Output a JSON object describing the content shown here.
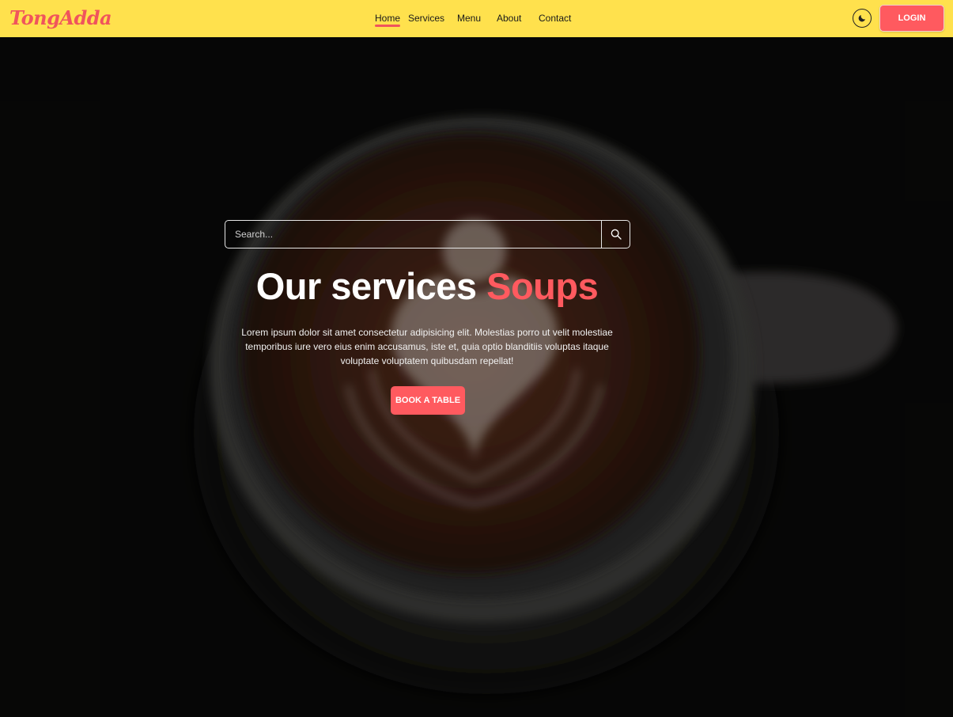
{
  "brand": {
    "logo_text": "TongAdda",
    "logo_color": "#f0545c"
  },
  "nav": {
    "items": [
      {
        "label": "Home",
        "active": true
      },
      {
        "label": "Services"
      },
      {
        "label": "Menu"
      },
      {
        "label": "About"
      },
      {
        "label": "Contact"
      }
    ]
  },
  "header": {
    "login_label": "LOGIN",
    "theme_icon": "moon-icon",
    "background": "#ffe14d"
  },
  "search": {
    "placeholder": "Search...",
    "icon": "search-icon"
  },
  "hero": {
    "headline_main": "Our services",
    "headline_accent": "Soups",
    "description": "Lorem ipsum dolor sit amet consectetur adipisicing elit. Molestias porro ut velit molestiae temporibus iure vero eius enim accusamus, iste et, quia optio blanditiis voluptas itaque voluptate voluptatem quibusdam repellat!",
    "cta_label": "BOOK A TABLE",
    "accent_color": "#ff5a5f"
  }
}
